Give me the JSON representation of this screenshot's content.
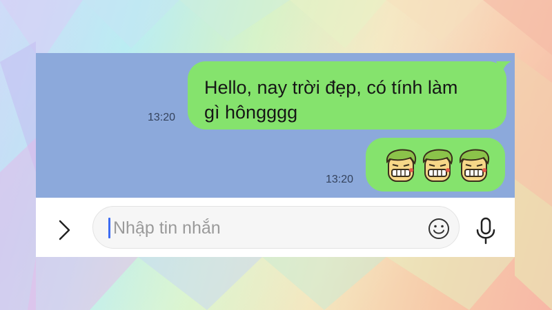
{
  "messages": [
    {
      "text_lines": [
        "Hello, nay trời đẹp, có tính làm",
        "gì hôngggg"
      ],
      "time": "13:20",
      "type": "text"
    },
    {
      "type": "sticker",
      "sticker_icon": "grinning-face-sticker-icon",
      "count": 3,
      "time": "13:20"
    }
  ],
  "input": {
    "placeholder": "Nhập tin nhắn",
    "expand_icon": "chevron-right-icon",
    "emoji_icon": "smiley-icon",
    "mic_icon": "microphone-icon"
  },
  "colors": {
    "chat_background": "#8ca9db",
    "bubble": "#85e36d",
    "input_bar": "#ffffff",
    "caret": "#3d6cf2"
  }
}
